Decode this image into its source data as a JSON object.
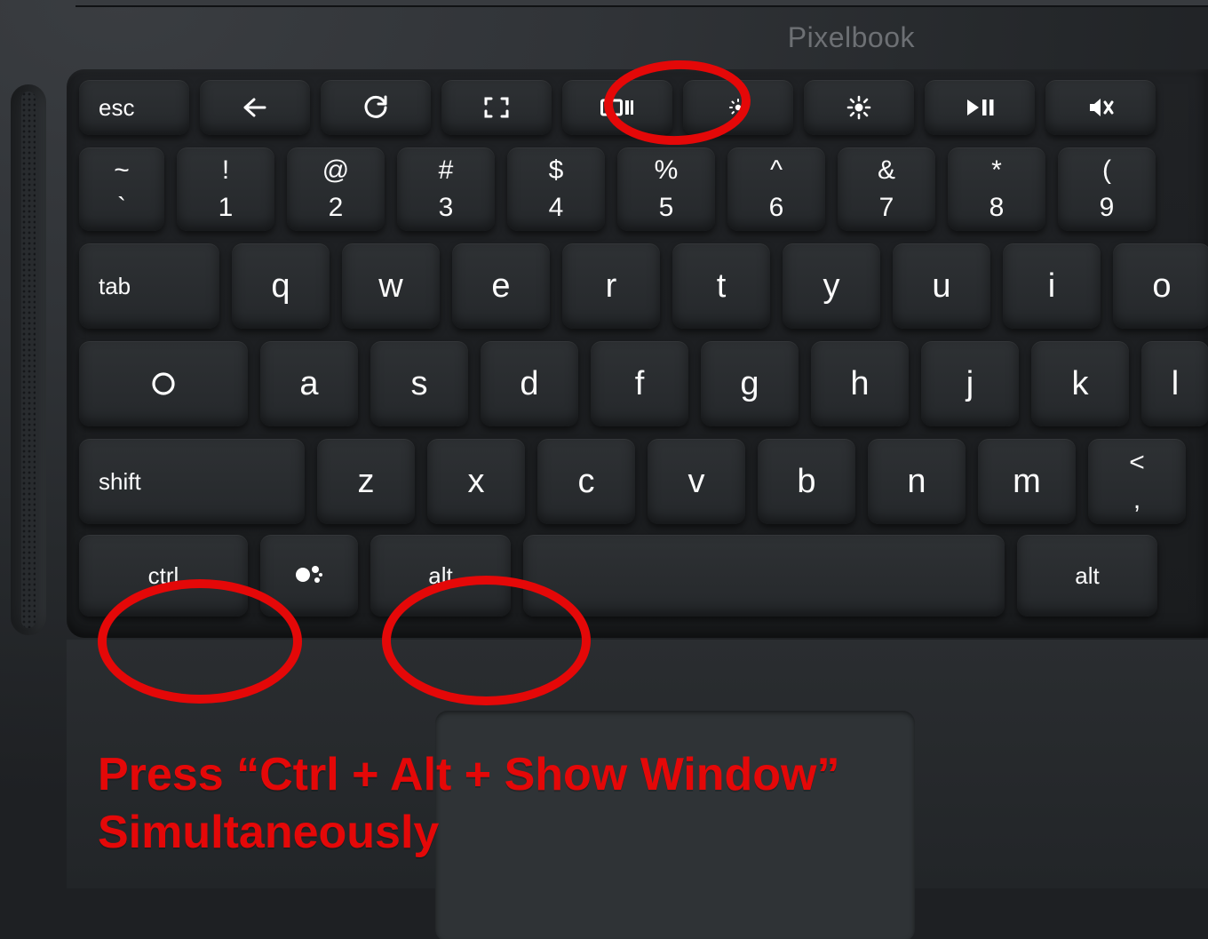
{
  "brand": "Pixelbook",
  "fn": {
    "esc": "esc"
  },
  "num": {
    "k1": {
      "t": "~",
      "b": "`"
    },
    "k2": {
      "t": "!",
      "b": "1"
    },
    "k3": {
      "t": "@",
      "b": "2"
    },
    "k4": {
      "t": "#",
      "b": "3"
    },
    "k5": {
      "t": "$",
      "b": "4"
    },
    "k6": {
      "t": "%",
      "b": "5"
    },
    "k7": {
      "t": "^",
      "b": "6"
    },
    "k8": {
      "t": "&",
      "b": "7"
    },
    "k9": {
      "t": "*",
      "b": "8"
    },
    "k10": {
      "t": "(",
      "b": "9"
    }
  },
  "q": {
    "tab": "tab",
    "q": "q",
    "w": "w",
    "e": "e",
    "r": "r",
    "t": "t",
    "y": "y",
    "u": "u",
    "i": "i",
    "o": "o"
  },
  "a": {
    "a": "a",
    "s": "s",
    "d": "d",
    "f": "f",
    "g": "g",
    "h": "h",
    "j": "j",
    "k": "k",
    "l": "l"
  },
  "z": {
    "shift": "shift",
    "z": "z",
    "x": "x",
    "c": "c",
    "v": "v",
    "b": "b",
    "n": "n",
    "m": "m",
    "lt_t": "<",
    "lt_b": ","
  },
  "bot": {
    "ctrl": "ctrl",
    "alt": "alt",
    "altR": "alt"
  },
  "caption_line1": "Press “Ctrl + Alt + Show Window”",
  "caption_line2": "Simultaneously"
}
